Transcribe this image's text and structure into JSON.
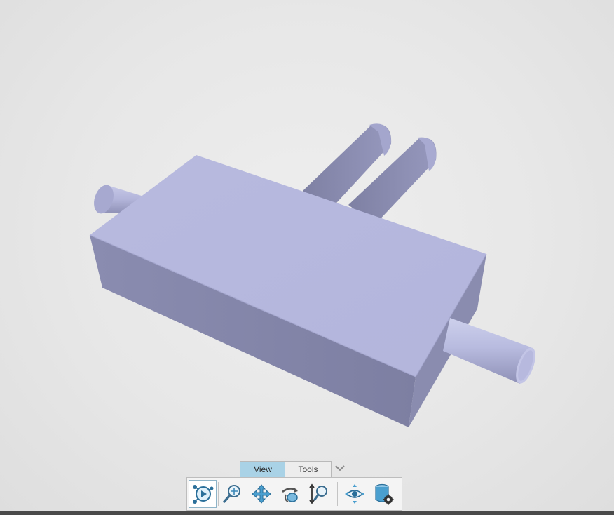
{
  "window": {
    "accent": "#a9d2e6",
    "model_color": "#b6b8de"
  },
  "viewport": {
    "model": "muffler-box-with-pipes-and-fins"
  },
  "ribbon": {
    "tabs": [
      {
        "label": "View",
        "active": true
      },
      {
        "label": "Tools",
        "active": false
      }
    ],
    "expand_icon": "chevron-down-icon"
  },
  "toolbar": {
    "tools": [
      {
        "name": "animate-play-icon",
        "active": true
      },
      {
        "name": "zoom-icon",
        "active": false
      },
      {
        "name": "pan-icon",
        "active": false
      },
      {
        "name": "rotate-icon",
        "active": false
      },
      {
        "name": "zoom-drag-icon",
        "active": false
      },
      {
        "name": "view-eye-icon",
        "active": false
      },
      {
        "name": "database-settings-icon",
        "active": false
      }
    ]
  }
}
